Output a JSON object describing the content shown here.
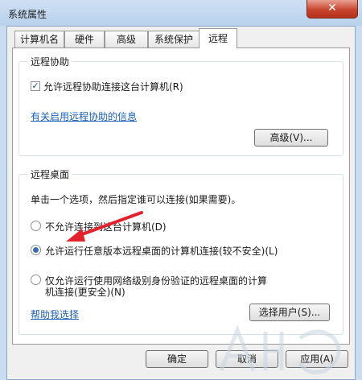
{
  "window": {
    "title": "系统属性",
    "close_glyph": "✕"
  },
  "tabs": [
    {
      "label": "计算机名"
    },
    {
      "label": "硬件"
    },
    {
      "label": "高级"
    },
    {
      "label": "系统保护"
    },
    {
      "label": "远程",
      "active": true
    }
  ],
  "remote_assistance": {
    "group_title": "远程协助",
    "allow_label": "允许远程协助连接这台计算机(R)",
    "allow_checked": true,
    "info_link": "有关启用远程协助的信息",
    "advanced_button": "高级(V)..."
  },
  "remote_desktop": {
    "group_title": "远程桌面",
    "instruction": "单击一个选项，然后指定谁可以连接(如果需要)。",
    "options": [
      {
        "label": "不允许连接到这台计算机(D)",
        "selected": false
      },
      {
        "label": "允许运行任意版本远程桌面的计算机连接(较不安全)(L)",
        "selected": true
      },
      {
        "label_line1": "仅允许运行使用网络级别身份验证的远程桌面的计算",
        "label_line2": "机连接(更安全)(N)",
        "selected": false
      }
    ],
    "help_link": "帮助我选择",
    "select_users_button": "选择用户(S)..."
  },
  "footer": {
    "ok_button": "确定",
    "cancel_button": "取消",
    "apply_button": "应用(A)"
  },
  "colors": {
    "accent": "#3d6fb0",
    "link": "#1a5fb4",
    "arrow": "#e0232c"
  }
}
